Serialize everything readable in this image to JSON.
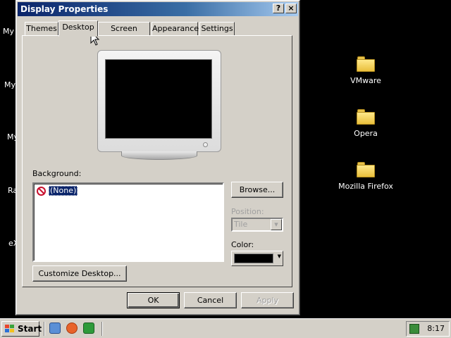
{
  "window": {
    "title": "Display Properties",
    "help_label": "?",
    "close_label": "×",
    "tabs": [
      "Themes",
      "Desktop",
      "Screen Saver",
      "Appearance",
      "Settings"
    ],
    "active_tab": "Desktop"
  },
  "desktop_panel": {
    "background_label": "Background:",
    "background_items": [
      "(None)"
    ],
    "selected_background": "(None)",
    "browse_label": "Browse...",
    "position_label": "Position:",
    "position_value": "Tile",
    "color_label": "Color:",
    "color_value": "#000000",
    "customize_label": "Customize Desktop..."
  },
  "buttons": {
    "ok": "OK",
    "cancel": "Cancel",
    "apply": "Apply"
  },
  "desktop": {
    "left_labels": [
      "My",
      "My",
      "My",
      "Ra",
      "eX"
    ],
    "icons": [
      "VMware",
      "Opera",
      "Mozilla Firefox"
    ]
  },
  "taskbar": {
    "start_label": "Start",
    "clock": "8:17",
    "quick_launch": [
      "show-desktop-icon",
      "browser-icon",
      "media-icon"
    ]
  },
  "colors": {
    "title_start": "#0a246a",
    "title_end": "#a6caf0",
    "face": "#d4d0c8",
    "selection": "#0a246a"
  }
}
